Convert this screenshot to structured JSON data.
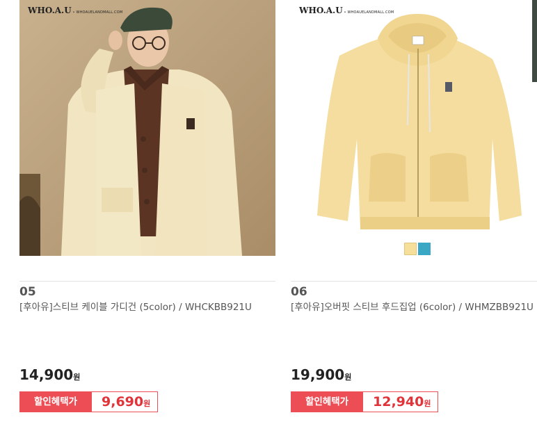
{
  "products": [
    {
      "brand": "WHO.A.U",
      "brand_url": "WHOAUELANDMALL.COM",
      "number": "05",
      "name": "[후아유]스티브 케이블 가디건 (5color) / WHCKBB921U",
      "price": "14,900",
      "price_unit": "원",
      "discount_label": "할인혜택가",
      "sale_price": "9,690",
      "sale_unit": "원",
      "colors": [
        "#f3e4bb"
      ]
    },
    {
      "brand": "WHO.A.U",
      "brand_url": "WHOAUELANDMALL.COM",
      "number": "06",
      "name": "[후아유]오버핏 스티브 후드집업 (6color) / WHMZBB921U",
      "price": "19,900",
      "price_unit": "원",
      "discount_label": "할인혜택가",
      "sale_price": "12,940",
      "sale_unit": "원",
      "colors": [
        "#f6de9b",
        "#3aa7c4"
      ]
    }
  ],
  "theme": {
    "accent": "#ed4e55",
    "sale_text": "#e0333a"
  }
}
